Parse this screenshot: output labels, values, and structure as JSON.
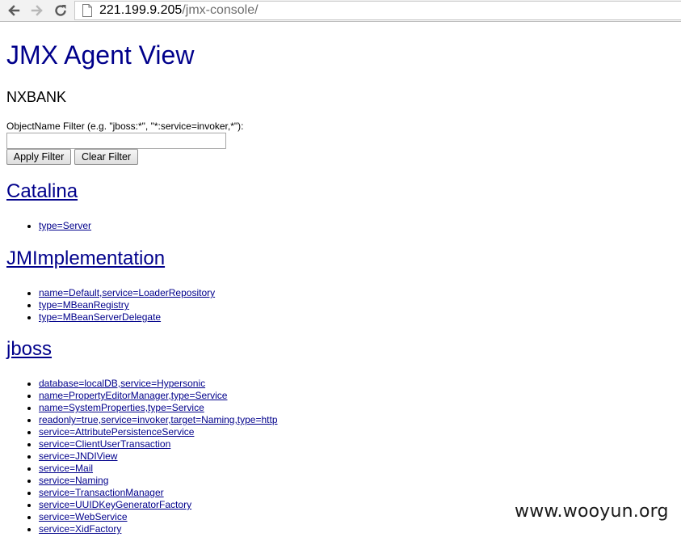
{
  "browser": {
    "url_host": "221.199.9.205",
    "url_path": "/jmx-console/",
    "back_icon": "back-arrow-icon",
    "forward_icon": "forward-arrow-icon",
    "reload_icon": "reload-icon",
    "page_icon": "page-icon"
  },
  "page": {
    "title": "JMX Agent View",
    "agent_name": "NXBANK",
    "filter_label": "ObjectName Filter (e.g. \"jboss:*\", \"*:service=invoker,*\"):",
    "filter_value": "",
    "apply_label": "Apply Filter",
    "clear_label": "Clear Filter"
  },
  "domains": [
    {
      "name": "Catalina",
      "mbeans": [
        "type=Server"
      ]
    },
    {
      "name": "JMImplementation",
      "mbeans": [
        "name=Default,service=LoaderRepository",
        "type=MBeanRegistry",
        "type=MBeanServerDelegate"
      ]
    },
    {
      "name": "jboss",
      "mbeans": [
        "database=localDB,service=Hypersonic",
        "name=PropertyEditorManager,type=Service",
        "name=SystemProperties,type=Service",
        "readonly=true,service=invoker,target=Naming,type=http",
        "service=AttributePersistenceService",
        "service=ClientUserTransaction",
        "service=JNDIView",
        "service=Mail",
        "service=Naming",
        "service=TransactionManager",
        "service=UUIDKeyGeneratorFactory",
        "service=WebService",
        "service=XidFactory"
      ]
    }
  ],
  "watermark": "www.wooyun.org"
}
